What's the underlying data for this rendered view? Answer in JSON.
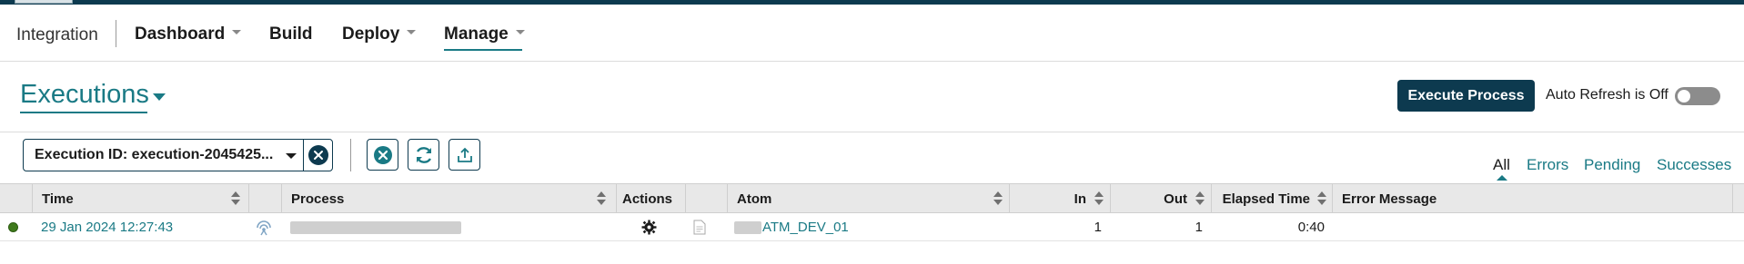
{
  "nav": {
    "integration": "Integration",
    "items": [
      {
        "label": "Dashboard"
      },
      {
        "label": "Build"
      },
      {
        "label": "Deploy"
      },
      {
        "label": "Manage"
      }
    ]
  },
  "page": {
    "title": "Executions",
    "execute_button": "Execute Process",
    "auto_refresh_label": "Auto Refresh is Off",
    "auto_refresh_on": false
  },
  "filter": {
    "label": "Execution ID: execution-2045425..."
  },
  "toolbar": {
    "icons": [
      "clear-filters-icon",
      "refresh-icon",
      "export-icon"
    ]
  },
  "status_tabs": [
    {
      "label": "All",
      "active": true
    },
    {
      "label": "Errors",
      "active": false
    },
    {
      "label": "Pending",
      "active": false
    },
    {
      "label": "Successes",
      "active": false
    }
  ],
  "table": {
    "columns": [
      "Time",
      "Process",
      "Actions",
      "Atom",
      "In",
      "Out",
      "Elapsed Time",
      "Error Message"
    ],
    "rows": [
      {
        "status": "success",
        "time": "29 Jan 2024 12:27:43",
        "process": "",
        "atom": "ATM_DEV_01",
        "in": "1",
        "out": "1",
        "elapsed": "0:40",
        "error": ""
      }
    ]
  },
  "colors": {
    "primary": "#0d3a4f",
    "link": "#1a7a85",
    "success": "#3f7a1c"
  }
}
